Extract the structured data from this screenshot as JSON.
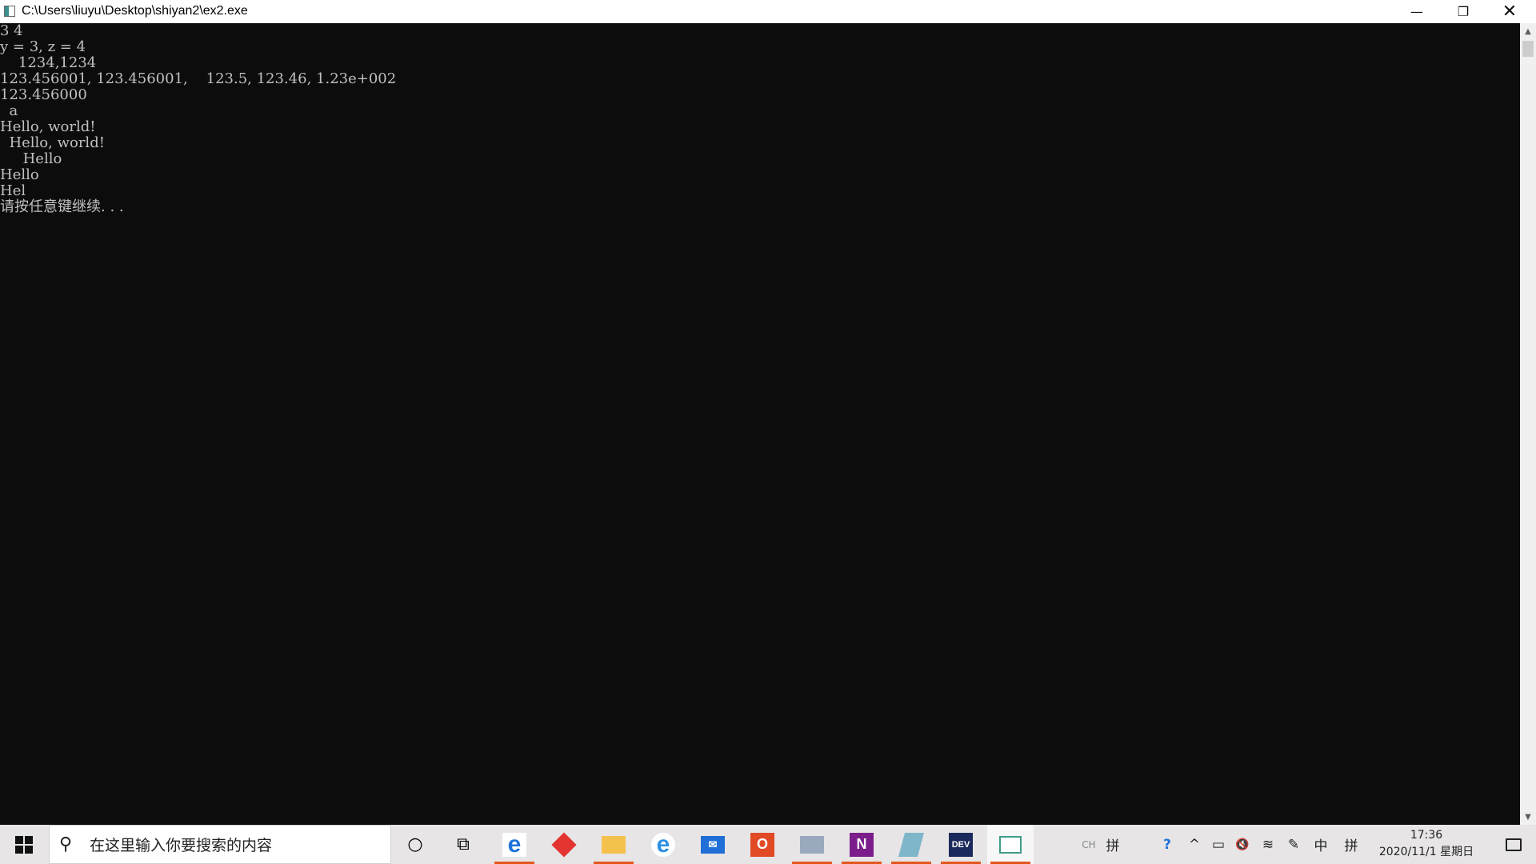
{
  "window": {
    "title": "C:\\Users\\liuyu\\Desktop\\shiyan2\\ex2.exe",
    "minimize_glyph": "—",
    "maximize_glyph": "❐",
    "close_glyph": "✕"
  },
  "console": {
    "lines": [
      "3 4",
      "y = 3, z = 4",
      "    1234,1234",
      "123.456001, 123.456001,    123.5, 123.46, 1.23e+002",
      "123.456000",
      "  a",
      "Hello, world!",
      "  Hello, world!",
      "     Hello",
      "Hello",
      "Hel",
      "请按任意键继续. . ."
    ]
  },
  "scrollbar": {
    "up_glyph": "▲",
    "down_glyph": "▼"
  },
  "taskbar": {
    "search_placeholder": "在这里输入你要搜索的内容",
    "search_icon": "search-icon",
    "cortana_glyph": "○",
    "taskview_glyph": "⧉",
    "apps": [
      {
        "name": "edge-icon",
        "label": "e",
        "color": "#1e73d8"
      },
      {
        "name": "red-diamond-app-icon",
        "label": "",
        "color": "#e3342f"
      },
      {
        "name": "file-explorer-icon",
        "label": "",
        "color": "#f4c24c"
      },
      {
        "name": "internet-explorer-icon",
        "label": "e",
        "color": "#2d8fe3"
      },
      {
        "name": "mail-icon",
        "label": "✉",
        "color": "#1f6fd6"
      },
      {
        "name": "office-icon",
        "label": "O",
        "color": "#e14a25"
      },
      {
        "name": "paint-icon",
        "label": "",
        "color": "#9aa9bd"
      },
      {
        "name": "onenote-icon",
        "label": "N",
        "color": "#7b1e8c"
      },
      {
        "name": "notepad-icon",
        "label": "",
        "color": "#7fb6c9"
      },
      {
        "name": "devcpp-icon",
        "label": "DEV",
        "color": "#1a2a5a"
      },
      {
        "name": "console-app-icon",
        "label": "",
        "color": "#3f9c8a"
      }
    ],
    "tray": {
      "ch_label": "CH",
      "pin_label": "拼",
      "help_glyph": "?",
      "chevron_glyph": "^",
      "battery_glyph": "▭",
      "volume_glyph": "🔇",
      "wifi_glyph": "≋",
      "pen_glyph": "✎",
      "lang_label": "中",
      "ime_label": "拼"
    },
    "clock_time": "17:36",
    "clock_date": "2020/11/1 星期日",
    "colors": {
      "taskbar_bg": "#e7e5e6",
      "active_underline": "#e3571e"
    }
  }
}
